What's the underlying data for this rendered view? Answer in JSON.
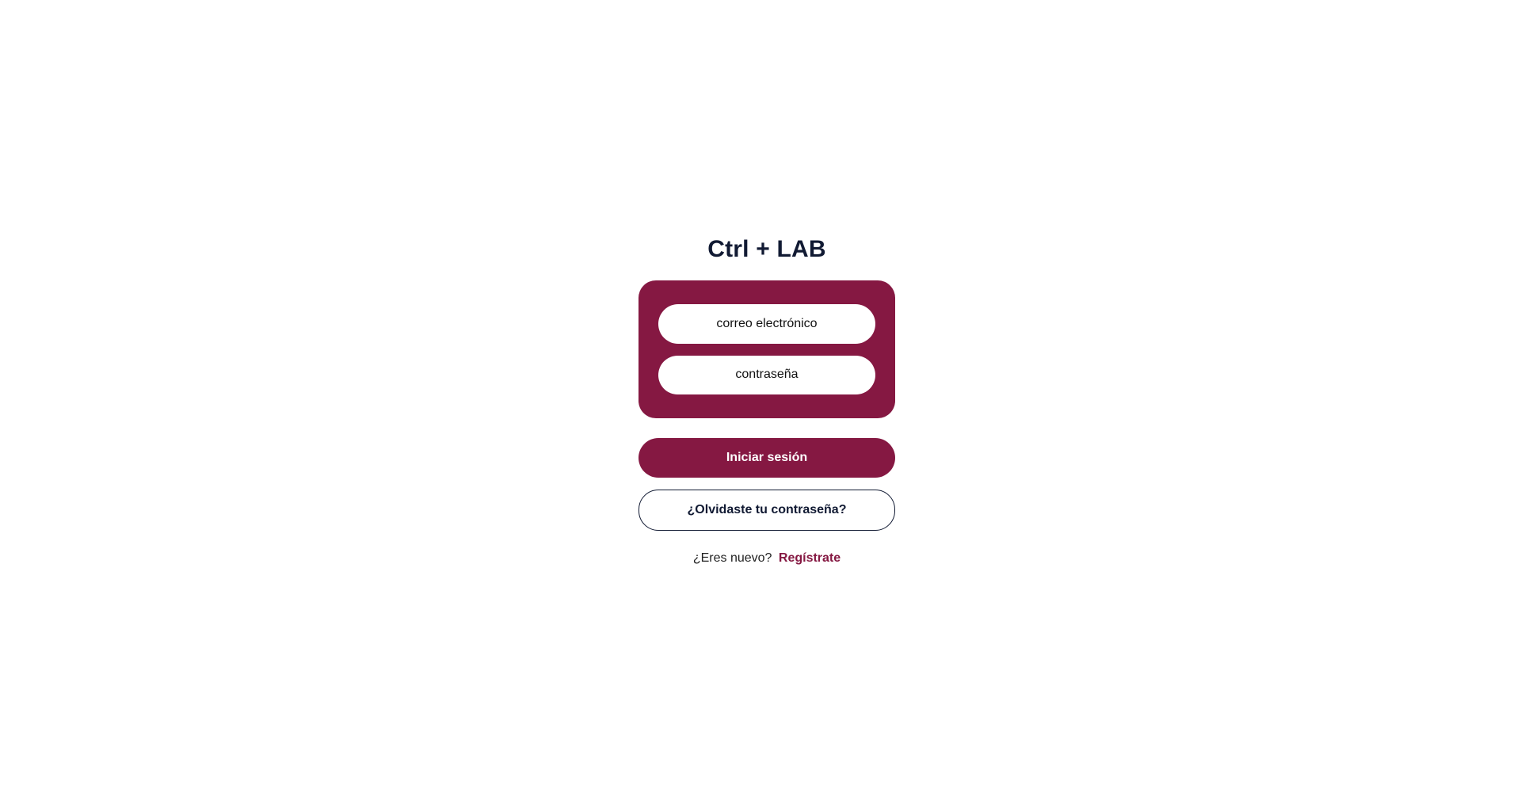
{
  "app": {
    "title": "Ctrl + LAB"
  },
  "login_form": {
    "email_placeholder": "correo electrónico",
    "password_placeholder": "contraseña",
    "submit_label": "Iniciar sesión",
    "forgot_password_label": "¿Olvidaste tu contraseña?"
  },
  "register": {
    "prompt_text": "¿Eres nuevo?",
    "link_label": "Regístrate"
  },
  "theme": {
    "accent_color": "#851842",
    "text_dark": "#111a33",
    "background": "#ffffff"
  }
}
